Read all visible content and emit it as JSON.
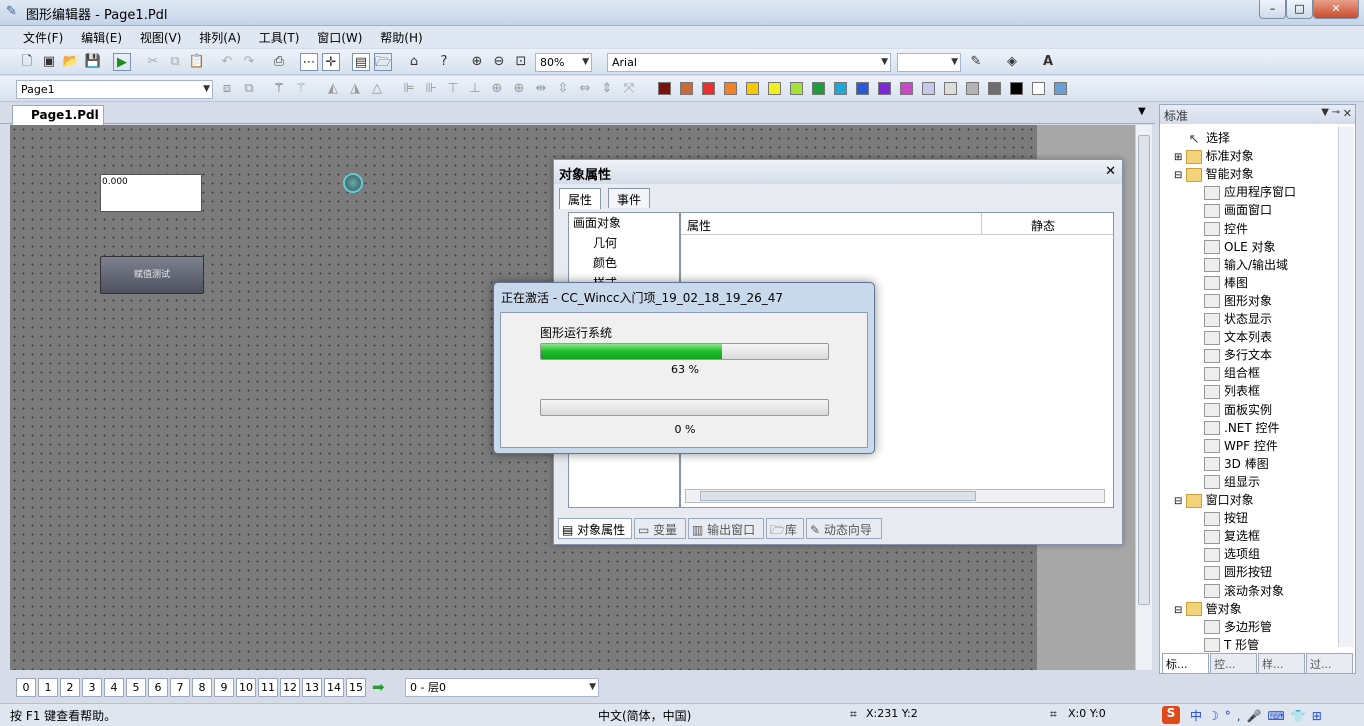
{
  "window": {
    "title": "图形编辑器 - Page1.Pdl",
    "min": "–",
    "max": "□",
    "close": "✕"
  },
  "menu": [
    "文件(F)",
    "编辑(E)",
    "视图(V)",
    "排列(A)",
    "工具(T)",
    "窗口(W)",
    "帮助(H)"
  ],
  "toolbar": {
    "zoom": "80%",
    "font": "Arial",
    "page_select": "Page1"
  },
  "doc_tab": {
    "label": "Page1.Pdl",
    "close": "✕"
  },
  "canvas": {
    "io_value": "0.000",
    "button_label": "赋值测试"
  },
  "palette": [
    "#7a1010",
    "#c86a3a",
    "#e83030",
    "#f0822a",
    "#f5c800",
    "#f0f020",
    "#a6e23a",
    "#1e9e3a",
    "#1ea6d6",
    "#2a5ad6",
    "#7a2ad6",
    "#c64ac6",
    "#c8c8ee",
    "#dcdcdc",
    "#b4b4b4",
    "#6e6e6e",
    "#000000",
    "#ffffff",
    "#6aa0d6"
  ],
  "props": {
    "title": "对象属性",
    "close": "✕",
    "tabs": [
      "属性",
      "事件"
    ],
    "tree": [
      "画面对象",
      "几何",
      "颜色",
      "样式"
    ],
    "columns": [
      "属性",
      "静态"
    ],
    "bottom_tabs": [
      "对象属性",
      "变量",
      "输出窗口",
      "库",
      "动态向导"
    ]
  },
  "modal": {
    "title": "正在激活 - CC_Wincc入门项_19_02_18_19_26_47",
    "label1": "图形运行系统",
    "progress1": 0.63,
    "progress1_text": "63 %",
    "progress2": 0,
    "progress2_text": "0 %"
  },
  "rpanel": {
    "title": "标准",
    "items": [
      {
        "label": "选择",
        "icon": "arrow-icon"
      },
      {
        "label": "标准对象",
        "icon": "folder-icon"
      },
      {
        "label": "智能对象",
        "icon": "folder-icon"
      },
      {
        "label": "应用程序窗口",
        "icon": "app-window-icon"
      },
      {
        "label": "画面窗口",
        "icon": "picture-window-icon"
      },
      {
        "label": "控件",
        "icon": "ocx-icon"
      },
      {
        "label": "OLE 对象",
        "icon": "ole-icon"
      },
      {
        "label": "输入/输出域",
        "icon": "io-field-icon"
      },
      {
        "label": "棒图",
        "icon": "bar-icon"
      },
      {
        "label": "图形对象",
        "icon": "graphic-icon"
      },
      {
        "label": "状态显示",
        "icon": "status-icon"
      },
      {
        "label": "文本列表",
        "icon": "textlist-icon"
      },
      {
        "label": "多行文本",
        "icon": "multiline-icon"
      },
      {
        "label": "组合框",
        "icon": "combobox-icon"
      },
      {
        "label": "列表框",
        "icon": "listbox-icon"
      },
      {
        "label": "面板实例",
        "icon": "faceplate-icon"
      },
      {
        "label": ".NET 控件",
        "icon": "net-icon"
      },
      {
        "label": "WPF 控件",
        "icon": "wpf-icon"
      },
      {
        "label": "3D 棒图",
        "icon": "3dbar-icon"
      },
      {
        "label": "组显示",
        "icon": "group-display-icon"
      },
      {
        "label": "窗口对象",
        "icon": "folder-icon"
      },
      {
        "label": "按钮",
        "icon": "button-icon"
      },
      {
        "label": "复选框",
        "icon": "checkbox-icon"
      },
      {
        "label": "选项组",
        "icon": "radio-icon"
      },
      {
        "label": "圆形按钮",
        "icon": "round-button-icon"
      },
      {
        "label": "滚动条对象",
        "icon": "scrollbar-icon"
      },
      {
        "label": "管对象",
        "icon": "folder-icon"
      },
      {
        "label": "多边形管",
        "icon": "pipe-icon"
      },
      {
        "label": "T 形管",
        "icon": "tpipe-icon"
      }
    ],
    "bottom_tabs": [
      "标...",
      "控...",
      "样...",
      "过..."
    ]
  },
  "pages": [
    "0",
    "1",
    "2",
    "3",
    "4",
    "5",
    "6",
    "7",
    "8",
    "9",
    "10",
    "11",
    "12",
    "13",
    "14",
    "15"
  ],
  "layer": "0 - 层0",
  "status": {
    "help": "按 F1 键查看帮助。",
    "lang": "中文(简体，中国)",
    "xy": "X:231 Y:2",
    "pos": "X:0 Y:0"
  }
}
